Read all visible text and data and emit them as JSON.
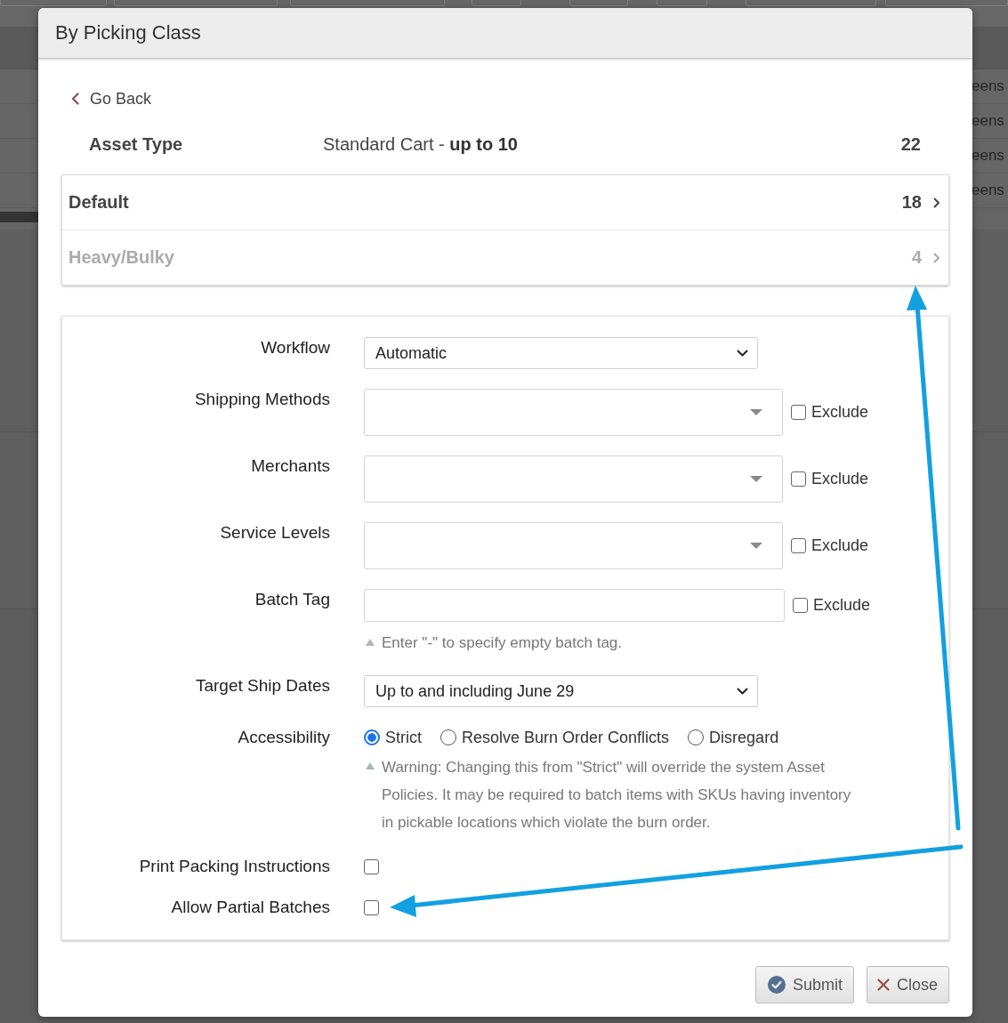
{
  "background": {
    "row_texts": [
      "eens",
      "eens",
      "eens",
      "eens"
    ]
  },
  "dialog": {
    "title": "By Picking Class"
  },
  "back_link": {
    "label": "Go Back"
  },
  "asset_type": {
    "label": "Asset Type",
    "value": "Standard Cart - **up to 10**",
    "count": "22"
  },
  "picking_classes": [
    {
      "name": "Default",
      "count": "18",
      "disabled": false
    },
    {
      "name": "Heavy/Bulky",
      "count": "4",
      "disabled": true
    }
  ],
  "form": {
    "fields": [
      {
        "kind": "select",
        "label": "Workflow",
        "value": "Automatic"
      },
      {
        "kind": "multiselect",
        "label": "Shipping Methods",
        "exclude": {
          "label": "Exclude",
          "checked": false
        }
      },
      {
        "kind": "multiselect",
        "label": "Merchants",
        "exclude": {
          "label": "Exclude",
          "checked": false
        }
      },
      {
        "kind": "multiselect",
        "label": "Service Levels",
        "exclude": {
          "label": "Exclude",
          "checked": false
        }
      },
      {
        "kind": "text",
        "label": "Batch Tag",
        "exclude": {
          "label": "Exclude",
          "checked": false
        },
        "hint": "Enter \"-\" to specify empty batch tag."
      },
      {
        "kind": "select",
        "label": "Target Ship Dates",
        "value": "Up to and including June 29"
      },
      {
        "kind": "radio",
        "label": "Accessibility",
        "options": [
          {
            "label": "Strict",
            "selected": true
          },
          {
            "label": "Resolve Burn Order Conflicts",
            "selected": false
          },
          {
            "label": "Disregard",
            "selected": false
          }
        ],
        "hint": "Warning: Changing this from \"Strict\" will override the system Asset Policies. It may be required to batch items with SKUs having inventory in pickable locations which violate the burn order."
      },
      {
        "kind": "checkbox",
        "label": "Print Packing Instructions",
        "checked": false
      },
      {
        "kind": "checkbox",
        "label": "Allow Partial Batches",
        "checked": false
      }
    ]
  },
  "buttons": [
    {
      "kind": "submit",
      "label": "Submit"
    },
    {
      "kind": "close",
      "label": "Close"
    }
  ]
}
